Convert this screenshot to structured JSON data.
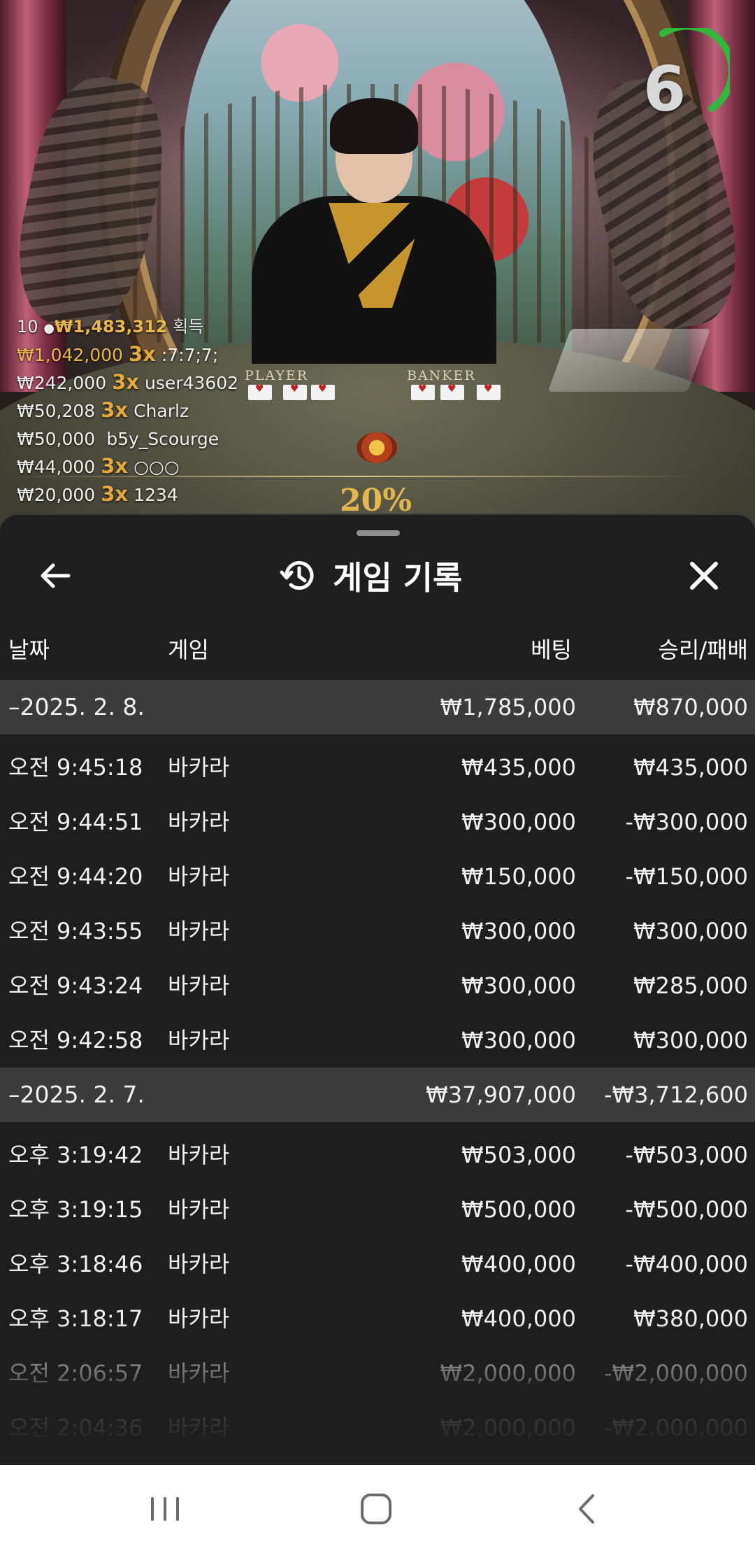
{
  "video": {
    "timer": "6",
    "table_labels": {
      "player": "PLAYER",
      "banker": "BANKER"
    },
    "commission": "20%",
    "winners_header": {
      "count": "10",
      "total": "₩1,483,312",
      "suffix": "획득"
    },
    "winners": [
      {
        "amount": "₩1,042,000",
        "mult": "3x",
        "name": ":7:7;7;",
        "gold": true
      },
      {
        "amount": "₩242,000",
        "mult": "3x",
        "name": "user43602",
        "gold": false
      },
      {
        "amount": "₩50,208",
        "mult": "3x",
        "name": "Charlz",
        "gold": false
      },
      {
        "amount": "₩50,000",
        "mult": "",
        "name": "b5y_Scourge",
        "gold": false
      },
      {
        "amount": "₩44,000",
        "mult": "3x",
        "name": "○○○",
        "gold": false
      },
      {
        "amount": "₩20,000",
        "mult": "3x",
        "name": "1234",
        "gold": false
      }
    ]
  },
  "sheet": {
    "title": "게임 기록",
    "columns": {
      "date": "날짜",
      "game": "게임",
      "bet": "베팅",
      "result": "승리/패배"
    },
    "groups": [
      {
        "date": "–2025. 2. 8.",
        "bet_total": "₩1,785,000",
        "result_total": "₩870,000",
        "rows": [
          {
            "time": "오전 9:45:18",
            "game": "바카라",
            "bet": "₩435,000",
            "result": "₩435,000"
          },
          {
            "time": "오전 9:44:51",
            "game": "바카라",
            "bet": "₩300,000",
            "result": "-₩300,000"
          },
          {
            "time": "오전 9:44:20",
            "game": "바카라",
            "bet": "₩150,000",
            "result": "-₩150,000"
          },
          {
            "time": "오전 9:43:55",
            "game": "바카라",
            "bet": "₩300,000",
            "result": "₩300,000"
          },
          {
            "time": "오전 9:43:24",
            "game": "바카라",
            "bet": "₩300,000",
            "result": "₩285,000"
          },
          {
            "time": "오전 9:42:58",
            "game": "바카라",
            "bet": "₩300,000",
            "result": "₩300,000"
          }
        ]
      },
      {
        "date": "–2025. 2. 7.",
        "bet_total": "₩37,907,000",
        "result_total": "-₩3,712,600",
        "rows": [
          {
            "time": "오후 3:19:42",
            "game": "바카라",
            "bet": "₩503,000",
            "result": "-₩503,000"
          },
          {
            "time": "오후 3:19:15",
            "game": "바카라",
            "bet": "₩500,000",
            "result": "-₩500,000"
          },
          {
            "time": "오후 3:18:46",
            "game": "바카라",
            "bet": "₩400,000",
            "result": "-₩400,000"
          },
          {
            "time": "오후 3:18:17",
            "game": "바카라",
            "bet": "₩400,000",
            "result": "₩380,000"
          },
          {
            "time": "오전 2:06:57",
            "game": "바카라",
            "bet": "₩2,000,000",
            "result": "-₩2,000,000"
          },
          {
            "time": "오전 2:04:36",
            "game": "바카라",
            "bet": "₩2,000,000",
            "result": "-₩2,000,000"
          }
        ]
      }
    ]
  },
  "navbar": {
    "icons": [
      "recent-apps-icon",
      "home-icon",
      "back-icon"
    ]
  },
  "colors": {
    "accent_gold": "#e3a93d",
    "timer_green": "#2fb83a",
    "group_row_bg": "#3b3b3b",
    "sheet_bg": "#1e1e1e"
  }
}
